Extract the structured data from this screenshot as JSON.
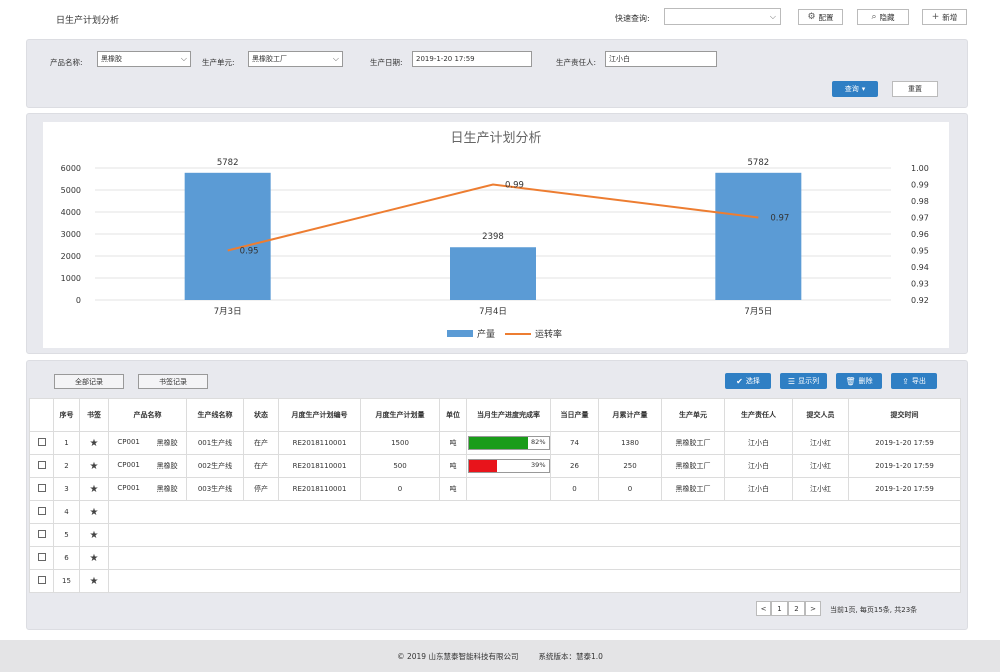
{
  "header": {
    "title": "日生产计划分析",
    "quick_search_label": "快速查询:",
    "quick_search_value": "",
    "config_label": "配置",
    "hide_label": "隐藏",
    "add_label": "新增"
  },
  "filters": {
    "product_label": "产品名称:",
    "product_value": "黑橡胶",
    "unit_label": "生产单元:",
    "unit_value": "黑橡胶工厂",
    "date_label": "生产日期:",
    "date_value": "2019-1-20 17:59",
    "owner_label": "生产责任人:",
    "owner_value": "江小白",
    "query_label": "查询",
    "reset_label": "重置"
  },
  "chart_data": {
    "type": "bar",
    "title": "日生产计划分析",
    "categories": [
      "7月3日",
      "7月4日",
      "7月5日"
    ],
    "series": [
      {
        "name": "产量",
        "type": "bar",
        "values": [
          5782,
          2398,
          5782
        ],
        "color": "#5b9bd5",
        "axis": "left"
      },
      {
        "name": "运转率",
        "type": "line",
        "values": [
          0.95,
          0.99,
          0.97
        ],
        "color": "#ed7d31",
        "axis": "right"
      }
    ],
    "y_left": {
      "min": 0,
      "max": 6000,
      "ticks": [
        "0",
        "1000",
        "2000",
        "3000",
        "4000",
        "5000",
        "6000"
      ]
    },
    "y_right": {
      "min": 0.92,
      "max": 1.0,
      "ticks": [
        "0.92",
        "0.93",
        "0.94",
        "0.95",
        "0.96",
        "0.97",
        "0.98",
        "0.99",
        "1.00"
      ]
    },
    "bar_labels": [
      "5782",
      "2398",
      "5782"
    ],
    "line_labels": [
      "0.95",
      "0.99",
      "0.97"
    ],
    "legend_placement": "bottom",
    "grid": true
  },
  "table_tabs": {
    "all": "全部记录",
    "bookmark": "书签记录"
  },
  "actions": {
    "select": "选择",
    "columns": "显示列",
    "delete": "删除",
    "export": "导出"
  },
  "columns": [
    "",
    "序号",
    "书签",
    "产品名称",
    "生产线名称",
    "状态",
    "月度生产计划编号",
    "月度生产计划量",
    "单位",
    "当月生产进度完成率",
    "当日产量",
    "月累计产量",
    "生产单元",
    "生产责任人",
    "提交人员",
    "提交时间"
  ],
  "rows": [
    {
      "no": "1",
      "code": "CP001",
      "name": "黑橡胶",
      "line": "001生产线",
      "status": "在产",
      "plan_no": "RE2018110001",
      "plan_qty": "1500",
      "unit": "吨",
      "progress": 0.82,
      "progress_label": "82%",
      "day_qty": "74",
      "month_qty": "1380",
      "prod_unit": "黑橡胶工厂",
      "owner": "江小白",
      "submitter": "江小红",
      "time": "2019-1-20 17:59"
    },
    {
      "no": "2",
      "code": "CP001",
      "name": "黑橡胶",
      "line": "002生产线",
      "status": "在产",
      "plan_no": "RE2018110001",
      "plan_qty": "500",
      "unit": "吨",
      "progress": 0.39,
      "progress_label": "39%",
      "day_qty": "26",
      "month_qty": "250",
      "prod_unit": "黑橡胶工厂",
      "owner": "江小白",
      "submitter": "江小红",
      "time": "2019-1-20 17:59"
    },
    {
      "no": "3",
      "code": "CP001",
      "name": "黑橡胶",
      "line": "003生产线",
      "status": "停产",
      "plan_no": "RE2018110001",
      "plan_qty": "0",
      "unit": "吨",
      "progress": null,
      "progress_label": "",
      "day_qty": "0",
      "month_qty": "0",
      "prod_unit": "黑橡胶工厂",
      "owner": "江小白",
      "submitter": "江小红",
      "time": "2019-1-20 17:59"
    }
  ],
  "empty_rows": [
    "4",
    "5",
    "6",
    "15"
  ],
  "pagination": {
    "prev": "<",
    "page1": "1",
    "page2": "2",
    "next": ">",
    "info": "当前1页, 每页15条, 共23条"
  },
  "footer": {
    "copyright": "© 2019 山东慧泰智能科技有限公司",
    "version": "系统版本：慧泰1.0"
  },
  "colors": {
    "accent": "#2f7fc4",
    "bar": "#5b9bd5",
    "line": "#ed7d31",
    "progress_high": "#1a9c1a",
    "progress_low": "#e8141b"
  }
}
